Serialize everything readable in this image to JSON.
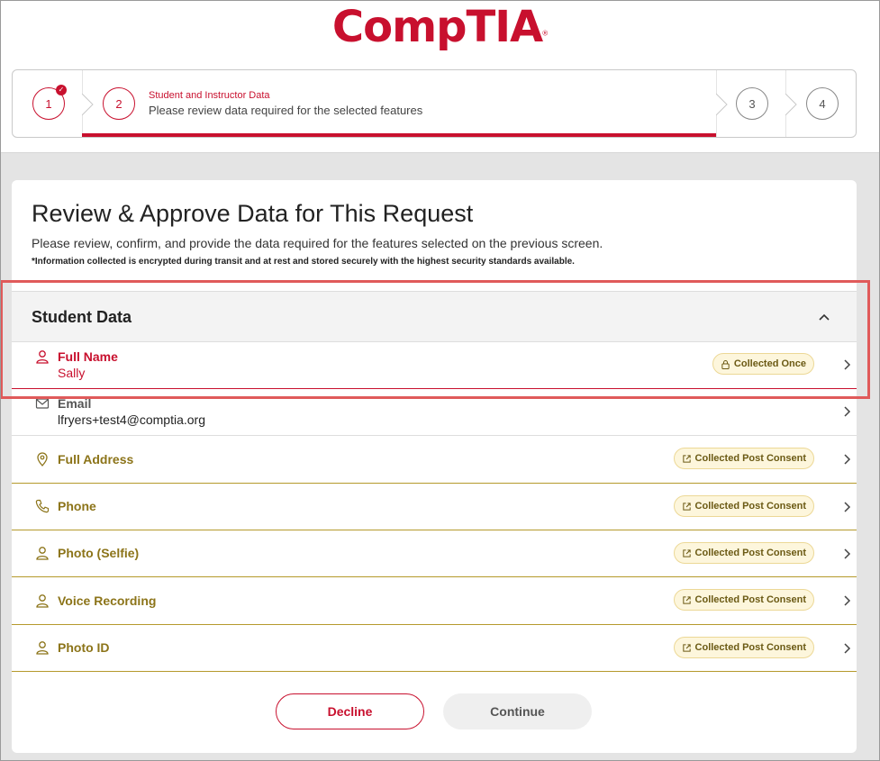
{
  "brand": {
    "logo_text": "CompTIA",
    "color": "#c8102e"
  },
  "stepper": {
    "steps": [
      {
        "number": "1",
        "completed": true
      },
      {
        "number": "2",
        "active": true
      },
      {
        "number": "3"
      },
      {
        "number": "4"
      }
    ],
    "current_title": "Student and Instructor Data",
    "current_description": "Please review data required for the selected features"
  },
  "page": {
    "title": "Review & Approve Data for This Request",
    "subtitle": "Please review, confirm, and provide the data required for the features selected on the previous screen.",
    "note": "*Information collected is encrypted during transit and at rest and stored securely with the highest security standards available."
  },
  "section": {
    "title": "Student Data"
  },
  "rows": [
    {
      "label": "Full Name",
      "value": "Sally",
      "badge": "Collected Once",
      "icon": "person-icon",
      "badge_icon": "lock-icon"
    },
    {
      "label": "Email",
      "value": "lfryers+test4@comptia.org",
      "badge": "",
      "icon": "envelope-icon"
    },
    {
      "label": "Full Address",
      "value": "",
      "badge": "Collected Post Consent",
      "icon": "location-pin-icon",
      "badge_icon": "external-link-icon"
    },
    {
      "label": "Phone",
      "value": "",
      "badge": "Collected Post Consent",
      "icon": "phone-icon",
      "badge_icon": "external-link-icon"
    },
    {
      "label": "Photo (Selfie)",
      "value": "",
      "badge": "Collected Post Consent",
      "icon": "person-icon",
      "badge_icon": "external-link-icon"
    },
    {
      "label": "Voice Recording",
      "value": "",
      "badge": "Collected Post Consent",
      "icon": "person-icon",
      "badge_icon": "external-link-icon"
    },
    {
      "label": "Photo ID",
      "value": "",
      "badge": "Collected Post Consent",
      "icon": "person-icon",
      "badge_icon": "external-link-icon"
    }
  ],
  "actions": {
    "decline": "Decline",
    "continue": "Continue"
  }
}
